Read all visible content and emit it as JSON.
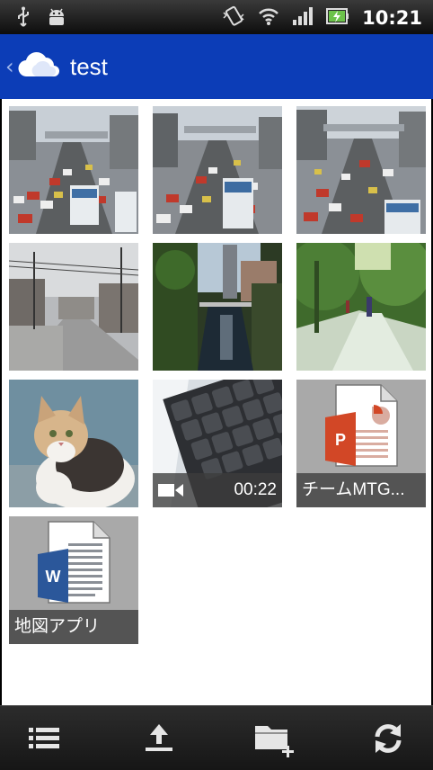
{
  "status_bar": {
    "time": "10:21",
    "icons": [
      "usb-icon",
      "android-debug-icon",
      "vibrate-icon",
      "wifi-icon",
      "signal-icon",
      "battery-charging-icon"
    ]
  },
  "action_bar": {
    "title": "test",
    "app_icon": "onedrive-cloud-icon",
    "back_icon": "chevron-left-icon"
  },
  "grid": {
    "items": [
      {
        "type": "photo",
        "subject": "traffic jam"
      },
      {
        "type": "photo",
        "subject": "traffic jam"
      },
      {
        "type": "photo",
        "subject": "traffic jam"
      },
      {
        "type": "photo",
        "subject": "street"
      },
      {
        "type": "photo",
        "subject": "canal"
      },
      {
        "type": "photo",
        "subject": "park path"
      },
      {
        "type": "photo",
        "subject": "cat"
      },
      {
        "type": "video",
        "duration": "00:22",
        "icon": "video-camera-icon"
      },
      {
        "type": "document",
        "kind": "powerpoint",
        "name": "チームMTG..."
      },
      {
        "type": "document",
        "kind": "word",
        "name": "地図アプリ"
      }
    ]
  },
  "bottom_bar": {
    "buttons": [
      "list-view-icon",
      "upload-icon",
      "new-folder-icon",
      "refresh-icon"
    ]
  },
  "colors": {
    "action_bar": "#0c3db7",
    "powerpoint": "#d24726",
    "word": "#2b579a"
  }
}
